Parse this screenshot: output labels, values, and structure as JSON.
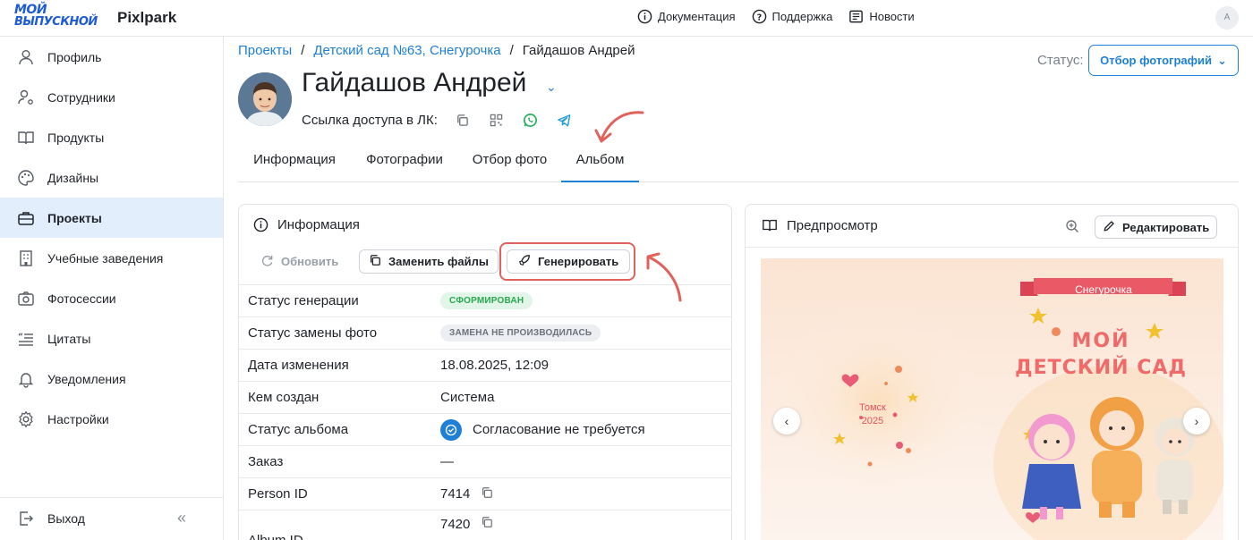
{
  "app": {
    "logo_line1": "МОЙ",
    "logo_line2": "ВЫПУСКНОЙ",
    "brand": "Pixlpark"
  },
  "topnav": [
    {
      "label": "Документация",
      "icon": "info-icon"
    },
    {
      "label": "Поддержка",
      "icon": "help-icon"
    },
    {
      "label": "Новости",
      "icon": "news-icon"
    }
  ],
  "user": {
    "avatar_letter": "A"
  },
  "sidebar": {
    "items": [
      {
        "label": "Профиль",
        "icon": "user-icon"
      },
      {
        "label": "Сотрудники",
        "icon": "staff-icon"
      },
      {
        "label": "Продукты",
        "icon": "book-icon"
      },
      {
        "label": "Дизайны",
        "icon": "palette-icon"
      },
      {
        "label": "Проекты",
        "icon": "briefcase-icon",
        "active": true
      },
      {
        "label": "Учебные заведения",
        "icon": "building-icon"
      },
      {
        "label": "Фотосессии",
        "icon": "camera-icon"
      },
      {
        "label": "Цитаты",
        "icon": "quote-icon"
      },
      {
        "label": "Уведомления",
        "icon": "bell-icon"
      },
      {
        "label": "Настройки",
        "icon": "gear-icon"
      }
    ],
    "logout_label": "Выход"
  },
  "breadcrumb": {
    "projects": "Проекты",
    "sep": "/",
    "kindergarten": "Детский сад №63, Снегурочка",
    "current": "Гайдашов Андрей"
  },
  "person": {
    "name": "Гайдашов Андрей",
    "access_label": "Ссылка доступа в ЛК:"
  },
  "status": {
    "label": "Статус:",
    "value": "Отбор фотографий"
  },
  "tabs": [
    {
      "label": "Информация"
    },
    {
      "label": "Фотографии"
    },
    {
      "label": "Отбор фото"
    },
    {
      "label": "Альбом",
      "active": true
    }
  ],
  "info_panel": {
    "title": "Информация",
    "refresh_label": "Обновить",
    "replace_label": "Заменить файлы",
    "generate_label": "Генерировать",
    "rows": [
      {
        "key": "Статус генерации",
        "badge": "СФОРМИРОВАН",
        "badge_color": "#2aa84f"
      },
      {
        "key": "Статус замены фото",
        "badge": "ЗАМЕНА НЕ ПРОИЗВОДИЛАСЬ",
        "badge_color": "#6d727a"
      },
      {
        "key": "Дата изменения",
        "value": "18.08.2025, 12:09"
      },
      {
        "key": "Кем создан",
        "value": "Система"
      },
      {
        "key": "Статус альбома",
        "value": "Согласование не требуется"
      },
      {
        "key": "Заказ",
        "value": "—"
      },
      {
        "key": "Person ID",
        "value": "7414"
      },
      {
        "key": "Album ID",
        "value": "7420"
      }
    ]
  },
  "preview_panel": {
    "title": "Предпросмотр",
    "edit_label": "Редактировать",
    "album": {
      "ribbon": "Снегурочка",
      "title_line1": "МОЙ",
      "title_line2": "ДЕТСКИЙ САД",
      "city": "Томск",
      "year": "2025"
    }
  },
  "colors": {
    "accent": "#1e7fd6",
    "active_bg": "#e3eefc",
    "annotation": "#e2625b"
  }
}
